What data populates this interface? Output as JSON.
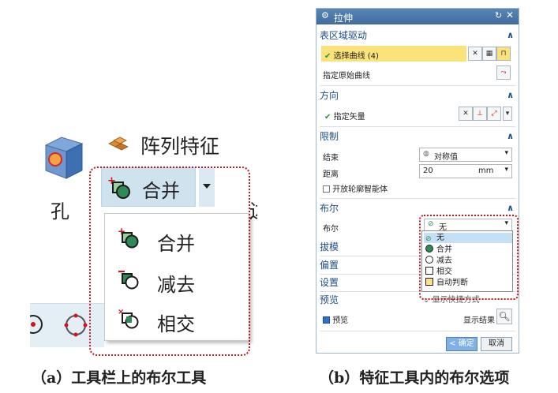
{
  "toolbar_panel": {
    "hole_label": "孔",
    "pattern_feature_label": "阵列特征",
    "combine_button_label": "合并",
    "partial_label": "边",
    "menu_items": [
      {
        "label": "合并",
        "icon": "boolean-unite-icon"
      },
      {
        "label": "减去",
        "icon": "boolean-subtract-icon"
      },
      {
        "label": "相交",
        "icon": "boolean-intersect-icon"
      }
    ],
    "caption": "（a）工具栏上的布尔工具"
  },
  "extrude_dialog": {
    "title": "拉伸",
    "sections": {
      "table_region": {
        "title": "表区域驱动",
        "select_curve": "选择曲线 (4)",
        "specify_original_curve": "指定原始曲线"
      },
      "direction": {
        "title": "方向",
        "specify_vector": "指定矢量"
      },
      "limits": {
        "title": "限制",
        "end_label": "结束",
        "end_value": "对称值",
        "distance_label": "距离",
        "distance_value": "20",
        "distance_unit": "mm",
        "open_profile": "开放轮廓智能体"
      },
      "boolean": {
        "title": "布尔",
        "boolean_label": "布尔",
        "selected": "无",
        "options": [
          "无",
          "合并",
          "减去",
          "相交",
          "自动判断"
        ],
        "show_shortcuts": "显示快捷方式"
      },
      "draft": {
        "title": "拔模"
      },
      "offset": {
        "title": "偏置"
      },
      "settings": {
        "title": "设置"
      },
      "preview": {
        "title": "预览",
        "preview_check": "预览",
        "show_result": "显示结果"
      }
    },
    "ok_button": "< 确定 >",
    "cancel_button": "取消",
    "caption": "（b）特征工具内的布尔选项"
  },
  "colors": {
    "accent": "#3f6c9f",
    "highlight": "#fbe27a",
    "dotted_border": "#d0141c",
    "toolbar_selected": "#cfe3ee"
  }
}
